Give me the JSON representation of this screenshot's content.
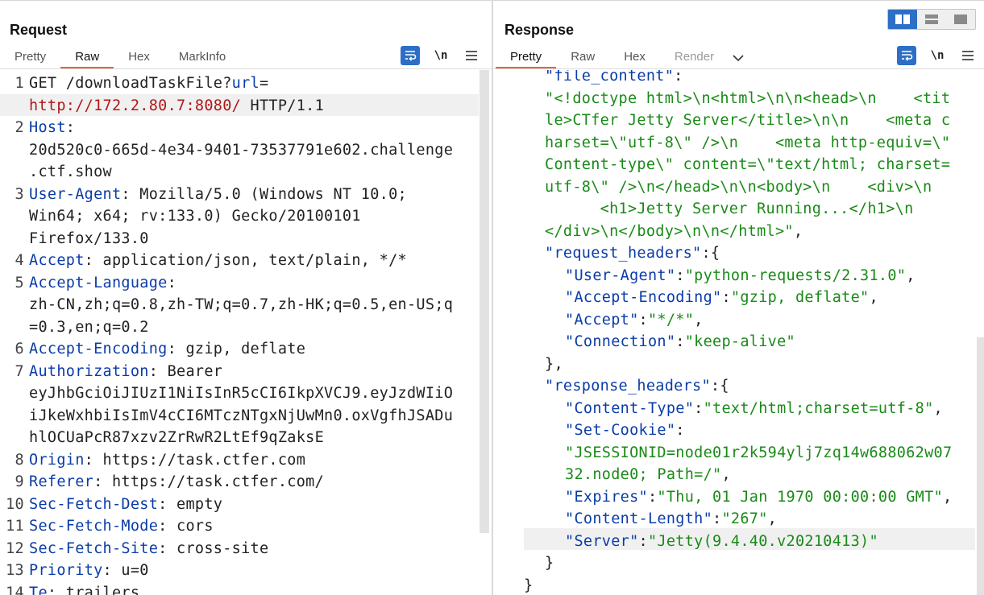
{
  "request": {
    "title": "Request",
    "tabs": [
      "Pretty",
      "Raw",
      "Hex",
      "MarkInfo"
    ],
    "active_tab": "Raw",
    "newline_label": "\\n",
    "lines": [
      {
        "num": "1",
        "parts": [
          {
            "t": "GET /downloadTaskFile?",
            "c": "p"
          },
          {
            "t": "url",
            "c": "k"
          },
          {
            "t": "=",
            "c": "p"
          }
        ]
      },
      {
        "num": "",
        "parts": [
          {
            "t": "http://172.2.80.7:8080/",
            "c": "u"
          },
          {
            "t": " HTTP/1.1",
            "c": "p"
          }
        ]
      },
      {
        "num": "2",
        "parts": [
          {
            "t": "Host",
            "c": "hk"
          },
          {
            "t": ":",
            "c": "p"
          }
        ]
      },
      {
        "num": "",
        "parts": [
          {
            "t": "20d520c0-665d-4e34-9401-73537791e602.challenge",
            "c": "p"
          }
        ]
      },
      {
        "num": "",
        "parts": [
          {
            "t": ".ctf.show",
            "c": "p"
          }
        ]
      },
      {
        "num": "3",
        "parts": [
          {
            "t": "User-Agent",
            "c": "hk"
          },
          {
            "t": ": Mozilla/5.0 (Windows NT 10.0;",
            "c": "p"
          }
        ]
      },
      {
        "num": "",
        "parts": [
          {
            "t": "Win64; x64; rv:133.0) Gecko/20100101",
            "c": "p"
          }
        ]
      },
      {
        "num": "",
        "parts": [
          {
            "t": "Firefox/133.0",
            "c": "p"
          }
        ]
      },
      {
        "num": "4",
        "parts": [
          {
            "t": "Accept",
            "c": "hk"
          },
          {
            "t": ": application/json, text/plain, */*",
            "c": "p"
          }
        ]
      },
      {
        "num": "5",
        "parts": [
          {
            "t": "Accept-Language",
            "c": "hk"
          },
          {
            "t": ":",
            "c": "p"
          }
        ]
      },
      {
        "num": "",
        "parts": [
          {
            "t": "zh-CN,zh;q=0.8,zh-TW;q=0.7,zh-HK;q=0.5,en-US;q",
            "c": "p"
          }
        ]
      },
      {
        "num": "",
        "parts": [
          {
            "t": "=0.3,en;q=0.2",
            "c": "p"
          }
        ]
      },
      {
        "num": "6",
        "parts": [
          {
            "t": "Accept-Encoding",
            "c": "hk"
          },
          {
            "t": ": gzip, deflate",
            "c": "p"
          }
        ]
      },
      {
        "num": "7",
        "parts": [
          {
            "t": "Authorization",
            "c": "hk"
          },
          {
            "t": ": Bearer",
            "c": "p"
          }
        ]
      },
      {
        "num": "",
        "parts": [
          {
            "t": "eyJhbGciOiJIUzI1NiIsInR5cCI6IkpXVCJ9.eyJzdWIiO",
            "c": "p"
          }
        ]
      },
      {
        "num": "",
        "parts": [
          {
            "t": "iJkeWxhbiIsImV4cCI6MTczNTgxNjUwMn0.oxVgfhJSADu",
            "c": "p"
          }
        ]
      },
      {
        "num": "",
        "parts": [
          {
            "t": "hlOCUaPcR87xzv2ZrRwR2LtEf9qZaksE",
            "c": "p"
          }
        ]
      },
      {
        "num": "8",
        "parts": [
          {
            "t": "Origin",
            "c": "hk"
          },
          {
            "t": ": https://task.ctfer.com",
            "c": "p"
          }
        ]
      },
      {
        "num": "9",
        "parts": [
          {
            "t": "Referer",
            "c": "hk"
          },
          {
            "t": ": https://task.ctfer.com/",
            "c": "p"
          }
        ]
      },
      {
        "num": "10",
        "parts": [
          {
            "t": "Sec-Fetch-Dest",
            "c": "hk"
          },
          {
            "t": ": empty",
            "c": "p"
          }
        ]
      },
      {
        "num": "11",
        "parts": [
          {
            "t": "Sec-Fetch-Mode",
            "c": "hk"
          },
          {
            "t": ": cors",
            "c": "p"
          }
        ]
      },
      {
        "num": "12",
        "parts": [
          {
            "t": "Sec-Fetch-Site",
            "c": "hk"
          },
          {
            "t": ": cross-site",
            "c": "p"
          }
        ]
      },
      {
        "num": "13",
        "parts": [
          {
            "t": "Priority",
            "c": "hk"
          },
          {
            "t": ": u=0",
            "c": "p"
          }
        ]
      },
      {
        "num": "14",
        "parts": [
          {
            "t": "Te",
            "c": "hk"
          },
          {
            "t": ": trailers",
            "c": "p"
          }
        ]
      }
    ]
  },
  "response": {
    "title": "Response",
    "tabs": [
      "Pretty",
      "Raw",
      "Hex",
      "Render"
    ],
    "active_tab": "Pretty",
    "disabled_tab": "Render",
    "newline_label": "\\n",
    "lines": [
      {
        "indent": 1,
        "parts": [
          {
            "t": "\"file_content\"",
            "c": "jk"
          },
          {
            "t": ":",
            "c": "jp"
          }
        ]
      },
      {
        "indent": 1,
        "parts": [
          {
            "t": "\"<!doctype html>\\n<html>\\n\\n<head>\\n    <tit",
            "c": "js"
          }
        ]
      },
      {
        "indent": 1,
        "parts": [
          {
            "t": "le>CTfer Jetty Server</title>\\n\\n    <meta c",
            "c": "js"
          }
        ]
      },
      {
        "indent": 1,
        "parts": [
          {
            "t": "harset=\\\"utf-8\\\" />\\n    <meta http-equiv=\\\"",
            "c": "js"
          }
        ]
      },
      {
        "indent": 1,
        "parts": [
          {
            "t": "Content-type\\\" content=\\\"text/html; charset=",
            "c": "js"
          }
        ]
      },
      {
        "indent": 1,
        "parts": [
          {
            "t": "utf-8\\\" />\\n</head>\\n\\n<body>\\n    <div>\\n",
            "c": "js"
          }
        ]
      },
      {
        "indent": 1,
        "parts": [
          {
            "t": "      <h1>Jetty Server Running...</h1>\\n",
            "c": "js"
          }
        ]
      },
      {
        "indent": 1,
        "parts": [
          {
            "t": "</div>\\n</body>\\n\\n</html>\"",
            "c": "js"
          },
          {
            "t": ",",
            "c": "jp"
          }
        ]
      },
      {
        "indent": 1,
        "parts": [
          {
            "t": "\"request_headers\"",
            "c": "jk"
          },
          {
            "t": ":{",
            "c": "jp"
          }
        ]
      },
      {
        "indent": 2,
        "parts": [
          {
            "t": "\"User-Agent\"",
            "c": "jk"
          },
          {
            "t": ":",
            "c": "jp"
          },
          {
            "t": "\"python-requests/2.31.0\"",
            "c": "js"
          },
          {
            "t": ",",
            "c": "jp"
          }
        ]
      },
      {
        "indent": 2,
        "parts": [
          {
            "t": "\"Accept-Encoding\"",
            "c": "jk"
          },
          {
            "t": ":",
            "c": "jp"
          },
          {
            "t": "\"gzip, deflate\"",
            "c": "js"
          },
          {
            "t": ",",
            "c": "jp"
          }
        ]
      },
      {
        "indent": 2,
        "parts": [
          {
            "t": "\"Accept\"",
            "c": "jk"
          },
          {
            "t": ":",
            "c": "jp"
          },
          {
            "t": "\"*/*\"",
            "c": "js"
          },
          {
            "t": ",",
            "c": "jp"
          }
        ]
      },
      {
        "indent": 2,
        "parts": [
          {
            "t": "\"Connection\"",
            "c": "jk"
          },
          {
            "t": ":",
            "c": "jp"
          },
          {
            "t": "\"keep-alive\"",
            "c": "js"
          }
        ]
      },
      {
        "indent": 1,
        "parts": [
          {
            "t": "},",
            "c": "jp"
          }
        ]
      },
      {
        "indent": 1,
        "parts": [
          {
            "t": "\"response_headers\"",
            "c": "jk"
          },
          {
            "t": ":{",
            "c": "jp"
          }
        ]
      },
      {
        "indent": 2,
        "parts": [
          {
            "t": "\"Content-Type\"",
            "c": "jk"
          },
          {
            "t": ":",
            "c": "jp"
          },
          {
            "t": "\"text/html;charset=utf-8\"",
            "c": "js"
          },
          {
            "t": ",",
            "c": "jp"
          }
        ]
      },
      {
        "indent": 2,
        "parts": [
          {
            "t": "\"Set-Cookie\"",
            "c": "jk"
          },
          {
            "t": ":",
            "c": "jp"
          }
        ]
      },
      {
        "indent": 2,
        "parts": [
          {
            "t": "\"JSESSIONID=node01r2k594ylj7zq14w688062w07",
            "c": "js"
          }
        ]
      },
      {
        "indent": 2,
        "parts": [
          {
            "t": "32.node0; Path=/\"",
            "c": "js"
          },
          {
            "t": ",",
            "c": "jp"
          }
        ]
      },
      {
        "indent": 2,
        "parts": [
          {
            "t": "\"Expires\"",
            "c": "jk"
          },
          {
            "t": ":",
            "c": "jp"
          },
          {
            "t": "\"Thu, 01 Jan 1970 00:00:00 GMT\"",
            "c": "js"
          },
          {
            "t": ",",
            "c": "jp"
          }
        ]
      },
      {
        "indent": 2,
        "parts": [
          {
            "t": "\"Content-Length\"",
            "c": "jk"
          },
          {
            "t": ":",
            "c": "jp"
          },
          {
            "t": "\"267\"",
            "c": "js"
          },
          {
            "t": ",",
            "c": "jp"
          }
        ]
      },
      {
        "indent": 2,
        "parts": [
          {
            "t": "\"Server\"",
            "c": "jk"
          },
          {
            "t": ":",
            "c": "jp"
          },
          {
            "t": "\"Jetty(9.4.40.v20210413)\"",
            "c": "js"
          }
        ]
      },
      {
        "indent": 1,
        "parts": [
          {
            "t": "}",
            "c": "jp"
          }
        ]
      },
      {
        "indent": 0,
        "parts": [
          {
            "t": "}",
            "c": "jp"
          }
        ]
      }
    ]
  },
  "icons": {
    "wrap": "wrap-lines-icon",
    "menu": "hamburger-menu-icon",
    "chevron": "chevron-down-icon",
    "layout_split": "split-columns-icon",
    "layout_rows": "split-rows-icon",
    "layout_single": "single-pane-icon"
  },
  "colors": {
    "accent_tab": "#e8623a",
    "header_key": "#0a3ca8",
    "url": "#b01818",
    "json_string": "#1a8a18",
    "button_blue": "#2d6fc6"
  }
}
